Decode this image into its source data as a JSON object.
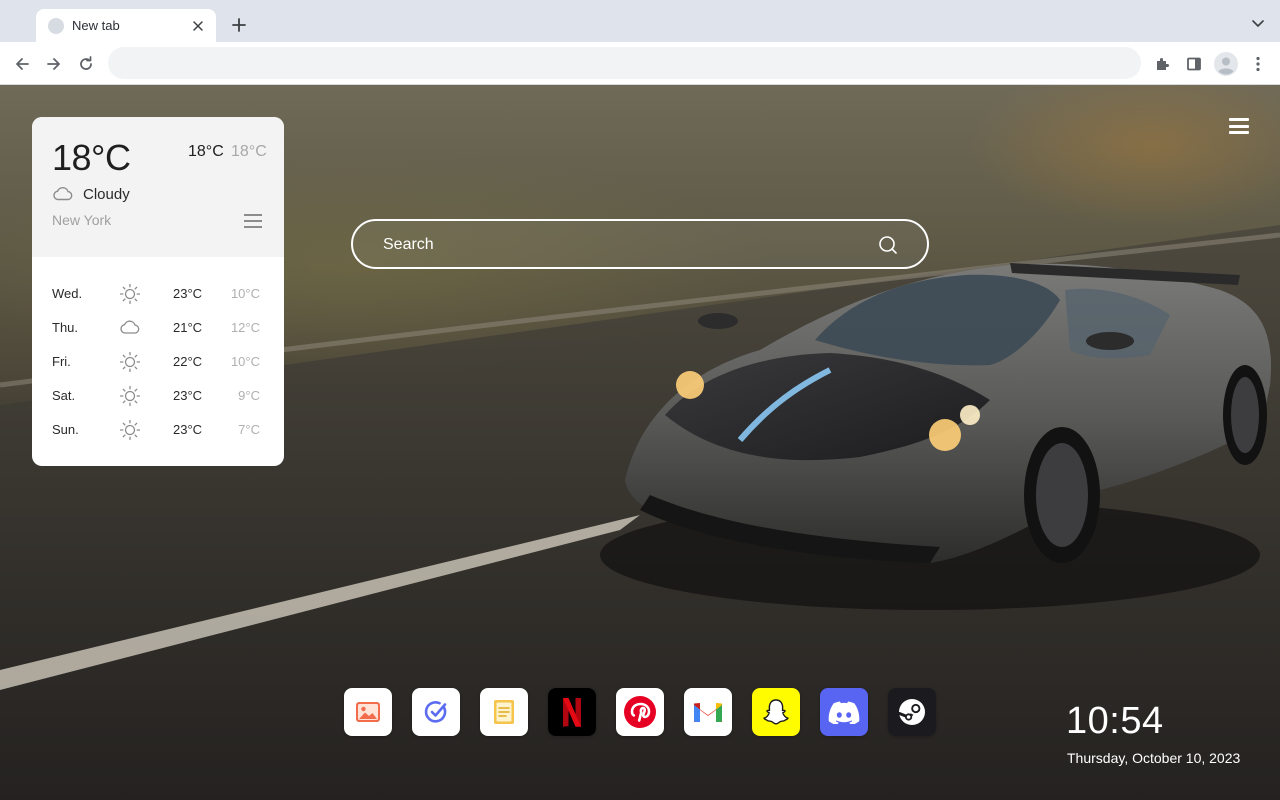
{
  "browser": {
    "tab": {
      "title": "New tab",
      "close_icon": "close-icon"
    },
    "newtab_icon": "plus-icon",
    "toolbar": {
      "back_icon": "arrow-left-icon",
      "forward_icon": "arrow-right-icon",
      "reload_icon": "reload-icon",
      "address_value": "",
      "extensions_icon": "puzzle-icon",
      "sidepanel_icon": "side-panel-icon",
      "profile_icon": "avatar-icon",
      "menu_icon": "kebab-menu-icon"
    }
  },
  "weather": {
    "current_temp": "18°C",
    "high": "18°C",
    "low": "18°C",
    "condition": "Cloudy",
    "city": "New York",
    "forecast": [
      {
        "day": "Wed.",
        "icon": "sun-icon",
        "high": "23°C",
        "low": "10°C"
      },
      {
        "day": "Thu.",
        "icon": "cloud-icon",
        "high": "21°C",
        "low": "12°C"
      },
      {
        "day": "Fri.",
        "icon": "sun-icon",
        "high": "22°C",
        "low": "10°C"
      },
      {
        "day": "Sat.",
        "icon": "sun-icon",
        "high": "23°C",
        "low": "9°C"
      },
      {
        "day": "Sun.",
        "icon": "sun-icon",
        "high": "23°C",
        "low": "7°C"
      }
    ]
  },
  "search": {
    "placeholder": "Search"
  },
  "dock": [
    {
      "name": "gallery",
      "icon": "image-icon",
      "bg": "#ffffff"
    },
    {
      "name": "todo",
      "icon": "check-circle-icon",
      "bg": "#ffffff"
    },
    {
      "name": "notes",
      "icon": "notes-icon",
      "bg": "#ffffff"
    },
    {
      "name": "netflix",
      "icon": "netflix-icon",
      "bg": "#000000"
    },
    {
      "name": "pinterest",
      "icon": "pinterest-icon",
      "bg": "#ffffff"
    },
    {
      "name": "gmail",
      "icon": "gmail-icon",
      "bg": "#ffffff"
    },
    {
      "name": "snapchat",
      "icon": "snapchat-icon",
      "bg": "#fffc00"
    },
    {
      "name": "discord",
      "icon": "discord-icon",
      "bg": "#5865f2"
    },
    {
      "name": "steam",
      "icon": "steam-icon",
      "bg": "#1b1b1f"
    }
  ],
  "clock": {
    "time": "10:54",
    "date": "Thursday, October 10, 2023"
  },
  "colors": {
    "chrome": "#dfe3eb",
    "netflix_red": "#e50914",
    "pinterest_red": "#e60023",
    "discord": "#5865f2",
    "snapchat": "#fffc00"
  }
}
